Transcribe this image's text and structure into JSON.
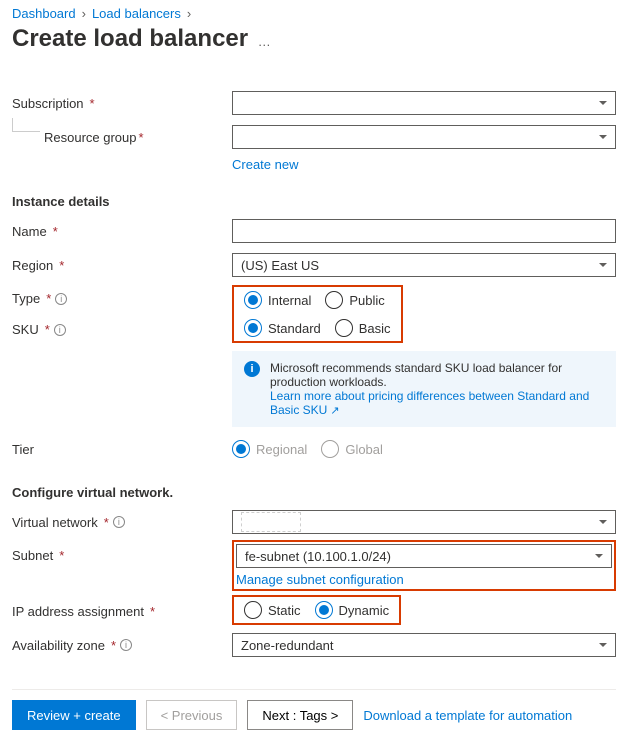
{
  "breadcrumb": {
    "items": [
      "Dashboard",
      "Load balancers"
    ],
    "sep": "›"
  },
  "page": {
    "title": "Create load balancer",
    "more": "…"
  },
  "labels": {
    "subscription": "Subscription",
    "resource_group": "Resource group",
    "create_new": "Create new",
    "instance_details": "Instance details",
    "name": "Name",
    "region": "Region",
    "type": "Type",
    "sku": "SKU",
    "tier": "Tier",
    "configure_vnet": "Configure virtual network.",
    "vnet": "Virtual network",
    "subnet": "Subnet",
    "manage_subnet": "Manage subnet configuration",
    "ip_assignment": "IP address assignment",
    "avail_zone": "Availability zone"
  },
  "values": {
    "subscription": "",
    "resource_group": "",
    "name": "",
    "region": "(US) East US",
    "vnet": "",
    "subnet": "fe-subnet (10.100.1.0/24)",
    "avail_zone": "Zone-redundant"
  },
  "radios": {
    "type": {
      "options": [
        "Internal",
        "Public"
      ],
      "selected": "Internal"
    },
    "sku": {
      "options": [
        "Standard",
        "Basic"
      ],
      "selected": "Standard"
    },
    "tier": {
      "options": [
        "Regional",
        "Global"
      ],
      "selected": "Regional",
      "disabled": true
    },
    "ip": {
      "options": [
        "Static",
        "Dynamic"
      ],
      "selected": "Dynamic"
    }
  },
  "callout": {
    "text": "Microsoft recommends standard SKU load balancer for production workloads.",
    "link": "Learn more about pricing differences between Standard and Basic SKU"
  },
  "footer": {
    "review": "Review + create",
    "previous": "< Previous",
    "next": "Next : Tags >",
    "template_link": "Download a template for automation"
  }
}
